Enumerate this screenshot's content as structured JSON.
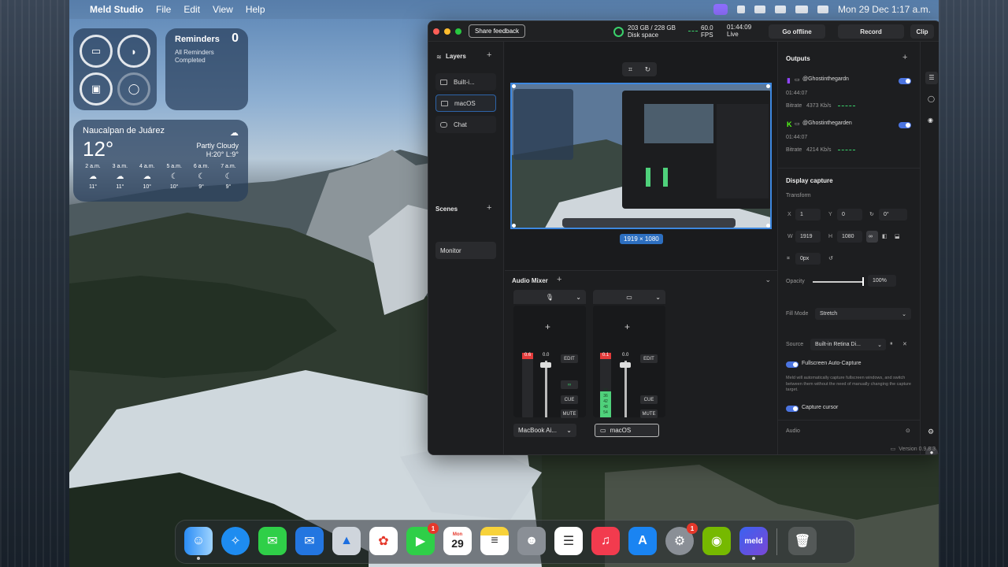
{
  "menubar": {
    "app_name": "Meld Studio",
    "menus": [
      "File",
      "Edit",
      "View",
      "Help"
    ],
    "clock": "Mon 29 Dec  1:17 a.m."
  },
  "widgets": {
    "reminders": {
      "title": "Reminders",
      "count": "0",
      "subtitle": "All Reminders Completed"
    },
    "weather": {
      "city": "Naucalpan de Juárez",
      "temp": "12°",
      "condition": "Partly Cloudy",
      "high_low": "H:20° L:9°",
      "hours": [
        {
          "time": "2 a.m.",
          "temp": "11°"
        },
        {
          "time": "3 a.m.",
          "temp": "11°"
        },
        {
          "time": "4 a.m.",
          "temp": "10°"
        },
        {
          "time": "5 a.m.",
          "temp": "10°"
        },
        {
          "time": "6 a.m.",
          "temp": "9°"
        },
        {
          "time": "7 a.m.",
          "temp": "9°"
        }
      ]
    }
  },
  "window": {
    "share_feedback": "Share feedback",
    "disk": {
      "value": "203 GB / 228 GB",
      "label": "Disk space"
    },
    "fps": {
      "value": "60.0",
      "label": "FPS"
    },
    "live": {
      "time": "01:44:09",
      "label": "Live"
    },
    "go_offline": "Go offline",
    "record": "Record",
    "clip": "Clip",
    "layers": {
      "title": "Layers",
      "items": [
        "Built-i...",
        "macOS",
        "Chat"
      ]
    },
    "scenes": {
      "title": "Scenes",
      "items": [
        "Monitor"
      ]
    },
    "resolution": "1919 × 1080",
    "audio_mixer": {
      "title": "Audio Mixer",
      "channels": [
        {
          "device": "MacBook Ai...",
          "peak": "0.6",
          "level_db": "0.0",
          "edit": "EDIT",
          "cue": "CUE",
          "mute": "MUTE",
          "level": 0.0
        },
        {
          "device": "macOS",
          "peak": "0.1",
          "level_db": "0.0",
          "edit": "EDIT",
          "cue": "CUE",
          "mute": "MUTE",
          "level": 0.4,
          "scale": [
            "30",
            "36",
            "42",
            "48",
            "54"
          ]
        }
      ]
    },
    "outputs": {
      "title": "Outputs",
      "items": [
        {
          "name": "@Ghostinthegardn",
          "time": "01:44:07",
          "bitrate_label": "Bitrate",
          "bitrate": "4373 Kb/s",
          "platform_icon": "twitch-icon"
        },
        {
          "name": "@Ghostinthegarden",
          "time": "01:44:07",
          "bitrate_label": "Bitrate",
          "bitrate": "4214 Kb/s",
          "platform_icon": "kick-icon"
        }
      ]
    },
    "display_capture": {
      "title": "Display capture",
      "transform_label": "Transform",
      "x_label": "X",
      "x": "1",
      "y_label": "Y",
      "y": "0",
      "rotation": "0°",
      "w_label": "W",
      "w": "1919",
      "h_label": "H",
      "h": "1080",
      "crop": "0px",
      "opacity_label": "Opacity",
      "opacity": "100%",
      "fill_mode_label": "Fill Mode",
      "fill_mode": "Stretch",
      "source_label": "Source",
      "source": "Built-in Retina Di...",
      "fullscreen_label": "Fullscreen Auto-Capture",
      "fullscreen_desc": "Meld will automatically capture fullscreen windows, and switch between them without the need of manually changing the capture target.",
      "capture_cursor_label": "Capture cursor",
      "audio_label": "Audio"
    },
    "version": "Version 0.9.8.3"
  },
  "dock": {
    "calendar_month": "Mon",
    "calendar_day": "29",
    "facetime_badge": "1",
    "settings_badge": "1",
    "meld_label": "meld"
  },
  "colors": {
    "accent": "#3d88e0",
    "live_green": "#3ad16b",
    "toggle": "#4b74e0",
    "peak_red": "#e33b3b"
  }
}
